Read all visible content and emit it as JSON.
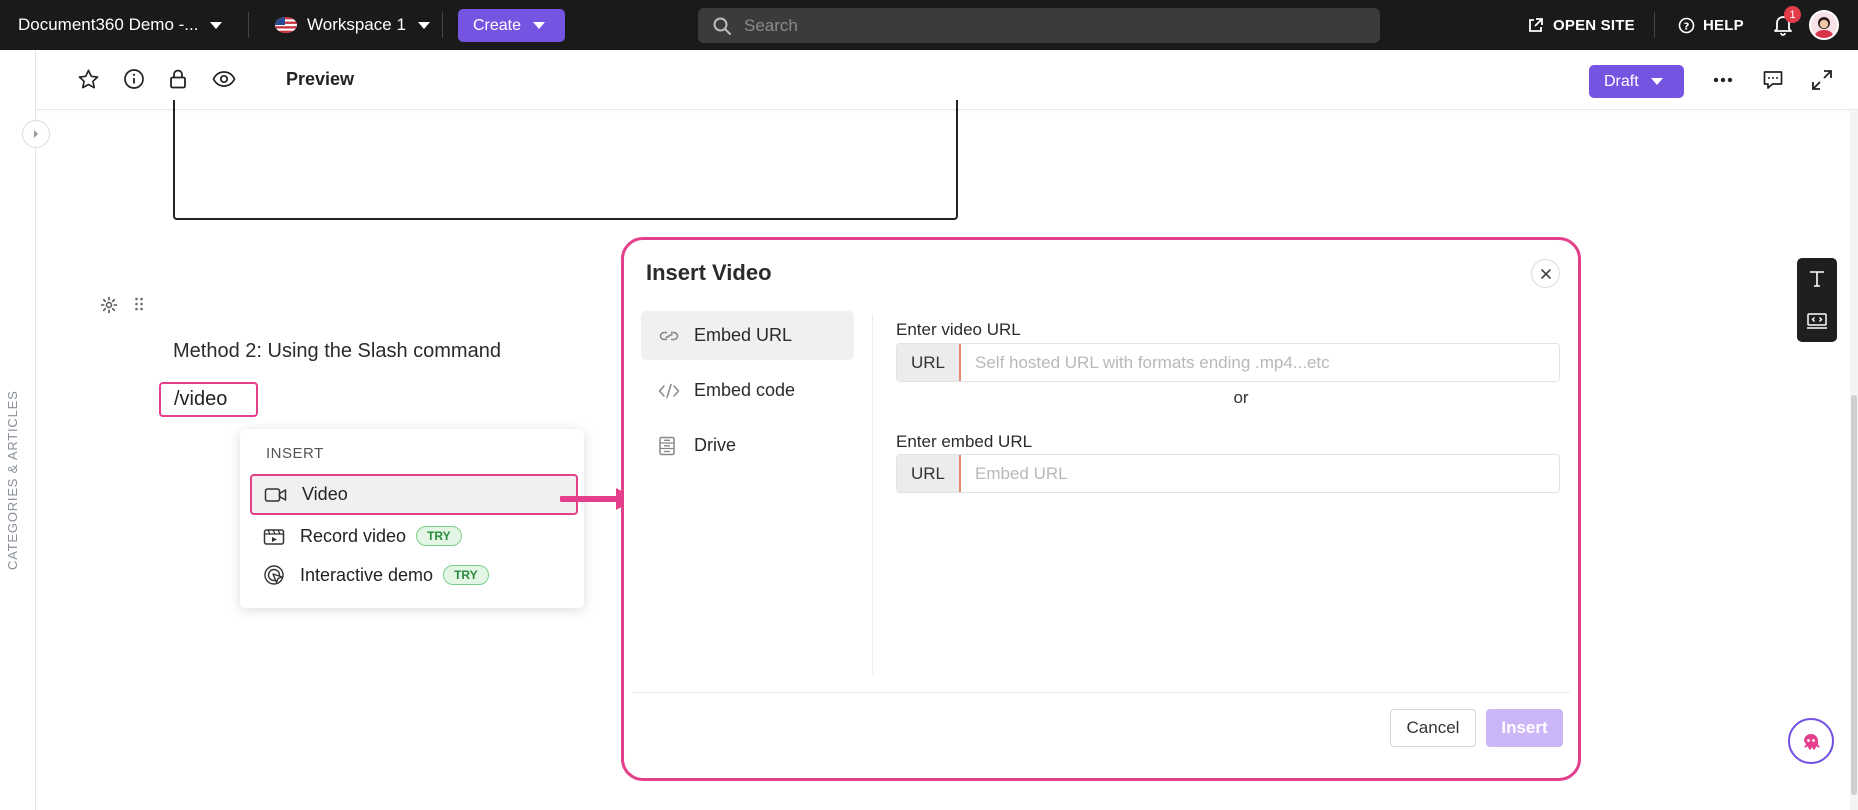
{
  "topbar": {
    "project_name": "Document360 Demo -...",
    "workspace": "Workspace 1",
    "create_label": "Create",
    "search_placeholder": "Search",
    "open_site": "OPEN SITE",
    "help": "HELP",
    "notification_count": "1"
  },
  "rail": {
    "label": "CATEGORIES & ARTICLES"
  },
  "toolbar": {
    "preview": "Preview",
    "status": "Draft"
  },
  "editor": {
    "method_text": "Method 2: Using the Slash command",
    "slash_command": "/video"
  },
  "slash_menu": {
    "heading": "INSERT",
    "items": [
      {
        "label": "Video",
        "icon": "video-camera-icon",
        "badge": ""
      },
      {
        "label": "Record video",
        "icon": "record-video-icon",
        "badge": "TRY"
      },
      {
        "label": "Interactive demo",
        "icon": "interactive-demo-icon",
        "badge": "TRY"
      }
    ]
  },
  "modal": {
    "title": "Insert Video",
    "tabs": [
      {
        "label": "Embed URL",
        "icon": "link-icon"
      },
      {
        "label": "Embed code",
        "icon": "code-icon"
      },
      {
        "label": "Drive",
        "icon": "drive-icon"
      }
    ],
    "video_url_label": "Enter video URL",
    "video_url_prefix": "URL",
    "video_url_placeholder": "Self hosted URL with formats ending .mp4...etc",
    "or_text": "or",
    "embed_url_label": "Enter embed URL",
    "embed_url_prefix": "URL",
    "embed_url_placeholder": "Embed URL",
    "cancel": "Cancel",
    "insert": "Insert"
  },
  "colors": {
    "accent": "#7454e0",
    "highlight": "#e43f8a",
    "topbar_bg": "#1a1a1a"
  }
}
